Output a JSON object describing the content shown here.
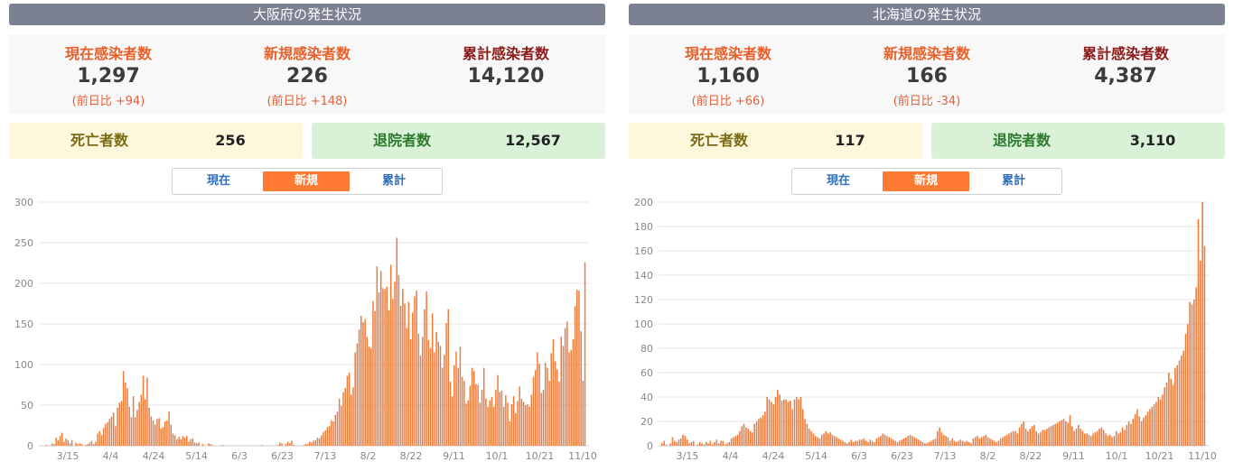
{
  "panels": [
    {
      "title": "大阪府の発生状況",
      "stats": {
        "current": {
          "label": "現在感染者数",
          "value": "1,297",
          "diff": "(前日比 +94)"
        },
        "new": {
          "label": "新規感染者数",
          "value": "226",
          "diff": "(前日比 +148)"
        },
        "total": {
          "label": "累計感染者数",
          "value": "14,120"
        }
      },
      "deaths": {
        "label": "死亡者数",
        "value": "256"
      },
      "discharged": {
        "label": "退院者数",
        "value": "12,567"
      },
      "tabs": [
        "現在",
        "新規",
        "累計"
      ],
      "active_tab": "新規"
    },
    {
      "title": "北海道の発生状況",
      "stats": {
        "current": {
          "label": "現在感染者数",
          "value": "1,160",
          "diff": "(前日比 +66)"
        },
        "new": {
          "label": "新規感染者数",
          "value": "166",
          "diff": "(前日比 -34)"
        },
        "total": {
          "label": "累計感染者数",
          "value": "4,387"
        }
      },
      "deaths": {
        "label": "死亡者数",
        "value": "117"
      },
      "discharged": {
        "label": "退院者数",
        "value": "3,110"
      },
      "tabs": [
        "現在",
        "新規",
        "累計"
      ],
      "active_tab": "新規"
    }
  ],
  "colors": {
    "bar": "#f07a3a",
    "header": "#7b8191",
    "tab_active": "#ff7a33"
  },
  "chart_data": [
    {
      "type": "bar",
      "ylim": [
        0,
        300
      ],
      "yticks": [
        0,
        50,
        100,
        150,
        200,
        250,
        300
      ],
      "xticks": [
        "3/15",
        "4/4",
        "4/24",
        "5/14",
        "6/3",
        "6/23",
        "7/13",
        "8/2",
        "8/22",
        "9/11",
        "10/1",
        "10/21",
        "11/10"
      ],
      "values": [
        0,
        0,
        1,
        0,
        0,
        3,
        2,
        10,
        7,
        12,
        16,
        5,
        9,
        7,
        3,
        7,
        0,
        4,
        2,
        3,
        2,
        0,
        1,
        2,
        4,
        6,
        2,
        5,
        15,
        18,
        13,
        22,
        27,
        29,
        33,
        36,
        41,
        24,
        47,
        53,
        55,
        92,
        78,
        71,
        48,
        35,
        61,
        35,
        44,
        54,
        63,
        86,
        57,
        84,
        47,
        36,
        31,
        26,
        33,
        34,
        21,
        23,
        30,
        31,
        42,
        26,
        15,
        13,
        8,
        11,
        8,
        12,
        10,
        12,
        5,
        8,
        9,
        4,
        3,
        4,
        0,
        2,
        0,
        0,
        3,
        2,
        1,
        0,
        0,
        0,
        0,
        1,
        0,
        0,
        0,
        0,
        0,
        0,
        0,
        0,
        0,
        0,
        0,
        0,
        0,
        0,
        0,
        0,
        0,
        0,
        0,
        1,
        0,
        0,
        0,
        0,
        0,
        0,
        0,
        1,
        4,
        3,
        0,
        2,
        5,
        3,
        6,
        1,
        0,
        0,
        0,
        0,
        1,
        2,
        2,
        5,
        4,
        6,
        7,
        10,
        9,
        13,
        17,
        19,
        23,
        24,
        31,
        30,
        38,
        42,
        58,
        49,
        66,
        71,
        86,
        90,
        63,
        72,
        115,
        126,
        143,
        160,
        152,
        156,
        134,
        122,
        120,
        178,
        166,
        221,
        189,
        215,
        194,
        193,
        196,
        167,
        223,
        181,
        202,
        256,
        210,
        172,
        193,
        175,
        145,
        177,
        131,
        164,
        184,
        191,
        138,
        111,
        134,
        168,
        190,
        130,
        120,
        163,
        115,
        140,
        128,
        123,
        96,
        112,
        151,
        168,
        79,
        61,
        99,
        116,
        96,
        122,
        85,
        80,
        52,
        56,
        74,
        96,
        92,
        76,
        75,
        53,
        69,
        96,
        58,
        48,
        56,
        60,
        48,
        69,
        87,
        66,
        68,
        48,
        62,
        53,
        30,
        51,
        61,
        40,
        55,
        73,
        58,
        54,
        50,
        51,
        48,
        63,
        85,
        93,
        115,
        101,
        65,
        69,
        102,
        96,
        80,
        114,
        131,
        104,
        94,
        79,
        134,
        123,
        145,
        153,
        115,
        118,
        131,
        172,
        192,
        191,
        141,
        80,
        226
      ]
    },
    {
      "type": "bar",
      "ylim": [
        0,
        200
      ],
      "yticks": [
        0,
        20,
        40,
        60,
        80,
        100,
        120,
        140,
        160,
        180,
        200
      ],
      "xticks": [
        "3/15",
        "4/4",
        "4/24",
        "5/14",
        "6/3",
        "6/23",
        "7/13",
        "8/2",
        "8/22",
        "9/11",
        "10/1",
        "10/21",
        "11/10"
      ],
      "values": [
        2,
        4,
        1,
        0,
        2,
        7,
        4,
        3,
        5,
        6,
        9,
        8,
        5,
        2,
        3,
        4,
        0,
        1,
        3,
        2,
        1,
        3,
        2,
        4,
        1,
        3,
        5,
        2,
        4,
        4,
        1,
        2,
        3,
        6,
        7,
        8,
        9,
        12,
        16,
        18,
        15,
        14,
        12,
        11,
        18,
        20,
        22,
        23,
        25,
        28,
        40,
        38,
        36,
        34,
        40,
        46,
        42,
        37,
        38,
        38,
        36,
        37,
        30,
        38,
        40,
        38,
        40,
        30,
        22,
        18,
        14,
        12,
        10,
        8,
        7,
        6,
        9,
        10,
        12,
        10,
        11,
        9,
        8,
        7,
        6,
        5,
        4,
        3,
        2,
        3,
        5,
        3,
        4,
        4,
        5,
        5,
        6,
        4,
        3,
        5,
        4,
        3,
        6,
        7,
        8,
        10,
        9,
        8,
        7,
        6,
        5,
        4,
        3,
        4,
        5,
        6,
        7,
        8,
        9,
        8,
        7,
        6,
        5,
        4,
        3,
        2,
        2,
        3,
        4,
        5,
        6,
        12,
        15,
        11,
        9,
        8,
        7,
        4,
        6,
        4,
        3,
        4,
        5,
        4,
        3,
        4,
        3,
        2,
        6,
        7,
        8,
        6,
        7,
        8,
        9,
        7,
        6,
        5,
        4,
        3,
        4,
        6,
        7,
        8,
        9,
        10,
        11,
        12,
        12,
        10,
        15,
        18,
        20,
        14,
        12,
        14,
        16,
        17,
        12,
        10,
        11,
        13,
        13,
        14,
        15,
        16,
        17,
        18,
        19,
        20,
        21,
        22,
        20,
        19,
        25,
        16,
        12,
        14,
        17,
        14,
        12,
        10,
        10,
        9,
        8,
        10,
        11,
        12,
        14,
        15,
        13,
        10,
        8,
        9,
        7,
        8,
        12,
        10,
        11,
        15,
        13,
        17,
        20,
        18,
        22,
        26,
        30,
        24,
        20,
        23,
        25,
        28,
        30,
        32,
        34,
        36,
        40,
        38,
        42,
        48,
        52,
        60,
        55,
        50,
        64,
        66,
        70,
        74,
        78,
        92,
        100,
        118,
        116,
        120,
        130,
        186,
        152,
        200,
        164
      ]
    }
  ]
}
